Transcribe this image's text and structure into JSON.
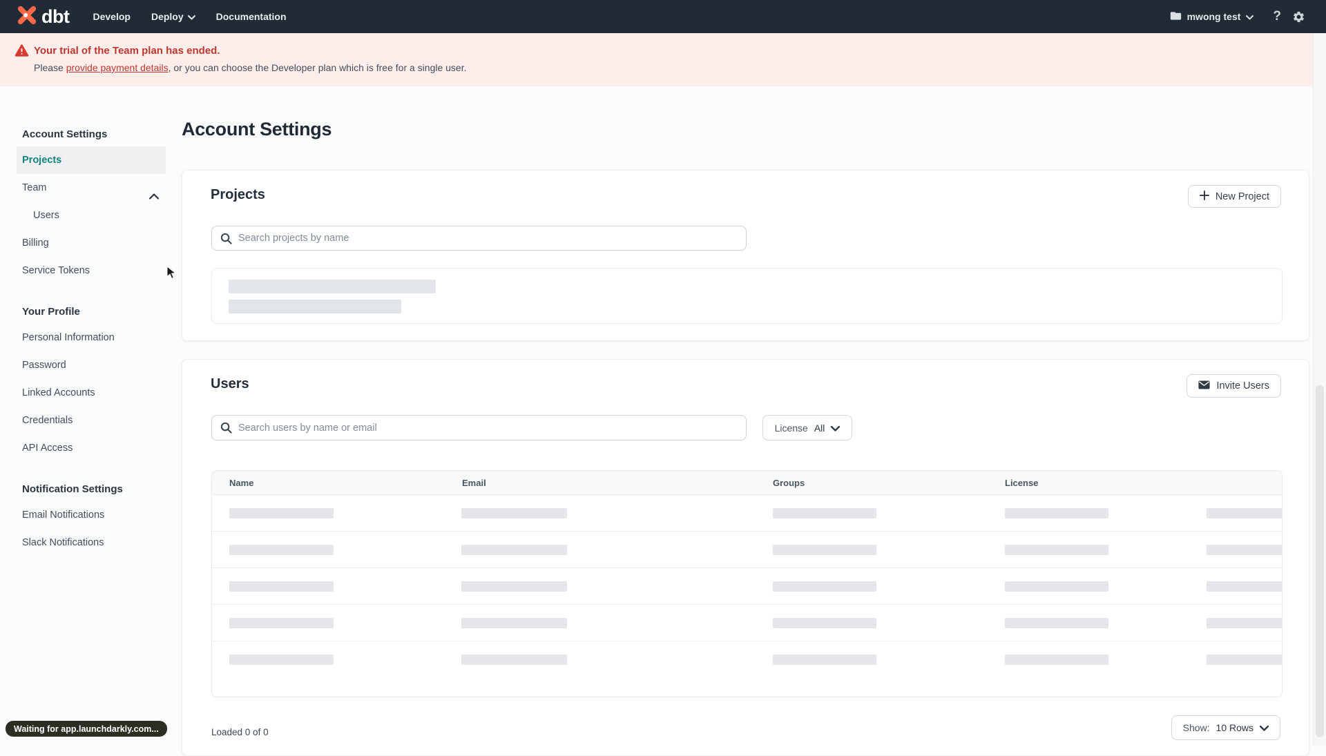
{
  "colors": {
    "nav_bg": "#202b36",
    "brand_orange": "#ff694a",
    "accent_teal": "#11847b",
    "banner_bg": "#fdeeec",
    "banner_red": "#bd372f",
    "skeleton_gray": "#e4e6e9"
  },
  "nav": {
    "logo_text": "dbt",
    "menu": [
      {
        "label": "Develop"
      },
      {
        "label": "Deploy"
      },
      {
        "label": "Documentation"
      }
    ],
    "account_name": "mwong test",
    "help_label": "?"
  },
  "banner": {
    "title": "Your trial of the Team plan has ended.",
    "message_prefix": "Please ",
    "link_text": "provide payment details",
    "message_suffix": ", or you can choose the Developer plan which is free for a single user."
  },
  "sidebar": {
    "account_header": "Account Settings",
    "projects": "Projects",
    "team": "Team",
    "users": "Users",
    "billing": "Billing",
    "service_tokens": "Service Tokens",
    "profile_header": "Your Profile",
    "personal_information": "Personal Information",
    "password": "Password",
    "linked_accounts": "Linked Accounts",
    "credentials": "Credentials",
    "api_access": "API Access",
    "notification_header": "Notification Settings",
    "email_notifications": "Email Notifications",
    "slack_notifications": "Slack Notifications"
  },
  "main": {
    "page_title": "Account Settings",
    "projects_card": {
      "title": "Projects",
      "new_project_button": "New Project",
      "search_placeholder": "Search projects by name"
    },
    "users_card": {
      "title": "Users",
      "invite_button": "Invite Users",
      "search_placeholder": "Search users by name or email",
      "license_filter_label": "License",
      "license_filter_value": "All",
      "table_headers": [
        "Name",
        "Email",
        "Groups",
        "License"
      ],
      "loaded_text": "Loaded 0 of 0",
      "show_label": "Show:",
      "show_value": "10 Rows"
    }
  },
  "status_tooltip": "Waiting for app.launchdarkly.com..."
}
